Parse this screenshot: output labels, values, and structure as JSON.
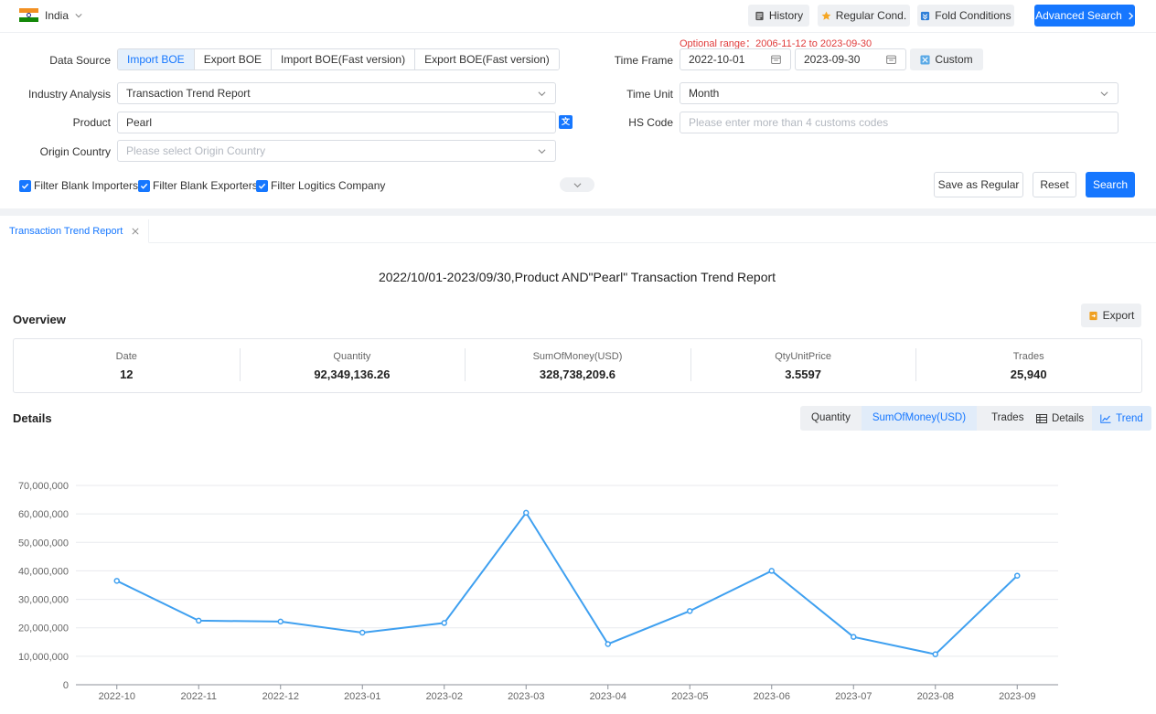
{
  "topbar": {
    "country": "India",
    "buttons": {
      "history": "History",
      "regular_cond": "Regular Cond.",
      "fold_conditions": "Fold Conditions",
      "advanced_search": "Advanced Search"
    }
  },
  "filters": {
    "optional_range": "Optional range：2006-11-12 to 2023-09-30",
    "data_source": {
      "label": "Data Source",
      "options": [
        "Import BOE",
        "Export BOE",
        "Import BOE(Fast version)",
        "Export BOE(Fast version)"
      ],
      "selected": "Import BOE"
    },
    "time_frame": {
      "label": "Time Frame",
      "from": "2022-10-01",
      "to": "2023-09-30",
      "custom_label": "Custom"
    },
    "industry_analysis": {
      "label": "Industry Analysis",
      "value": "Transaction Trend Report"
    },
    "time_unit": {
      "label": "Time Unit",
      "value": "Month"
    },
    "product": {
      "label": "Product",
      "value": "Pearl"
    },
    "hs_code": {
      "label": "HS Code",
      "placeholder": "Please enter more than 4 customs codes"
    },
    "origin_country": {
      "label": "Origin Country",
      "placeholder": "Please select Origin Country"
    },
    "checkboxes": [
      {
        "label": "Filter Blank Importers",
        "checked": true
      },
      {
        "label": "Filter Blank Exporters",
        "checked": true
      },
      {
        "label": "Filter Logitics Company",
        "checked": true
      }
    ],
    "buttons": {
      "save_regular": "Save as Regular",
      "reset": "Reset",
      "search": "Search"
    }
  },
  "report": {
    "tab_label": "Transaction Trend Report",
    "title": "2022/10/01-2023/09/30,Product AND\"Pearl\" Transaction Trend Report",
    "overview": {
      "heading": "Overview",
      "export_label": "Export",
      "stats": [
        {
          "key": "Date",
          "value": "12"
        },
        {
          "key": "Quantity",
          "value": "92,349,136.26"
        },
        {
          "key": "SumOfMoney(USD)",
          "value": "328,738,209.6"
        },
        {
          "key": "QtyUnitPrice",
          "value": "3.5597"
        },
        {
          "key": "Trades",
          "value": "25,940"
        }
      ]
    },
    "details": {
      "heading": "Details",
      "metric_tabs": [
        "Quantity",
        "SumOfMoney(USD)",
        "Trades"
      ],
      "active_metric": "SumOfMoney(USD)",
      "view_tabs": [
        "Details",
        "Trend"
      ],
      "active_view": "Trend"
    }
  },
  "chart_data": {
    "type": "line",
    "x": [
      "2022-10",
      "2022-11",
      "2022-12",
      "2023-01",
      "2023-02",
      "2023-03",
      "2023-04",
      "2023-05",
      "2023-06",
      "2023-07",
      "2023-08",
      "2023-09"
    ],
    "series": [
      {
        "values": [
          36500000,
          22500000,
          22200000,
          18300000,
          21700000,
          60400000,
          14300000,
          25900000,
          40000000,
          16800000,
          10700000,
          38300000
        ]
      }
    ],
    "ylim": [
      0,
      70000000
    ],
    "yticks": [
      "0",
      "10,000,000",
      "20,000,000",
      "30,000,000",
      "40,000,000",
      "50,000,000",
      "60,000,000",
      "70,000,000"
    ],
    "grid": true,
    "color": "#3fa0f0"
  }
}
